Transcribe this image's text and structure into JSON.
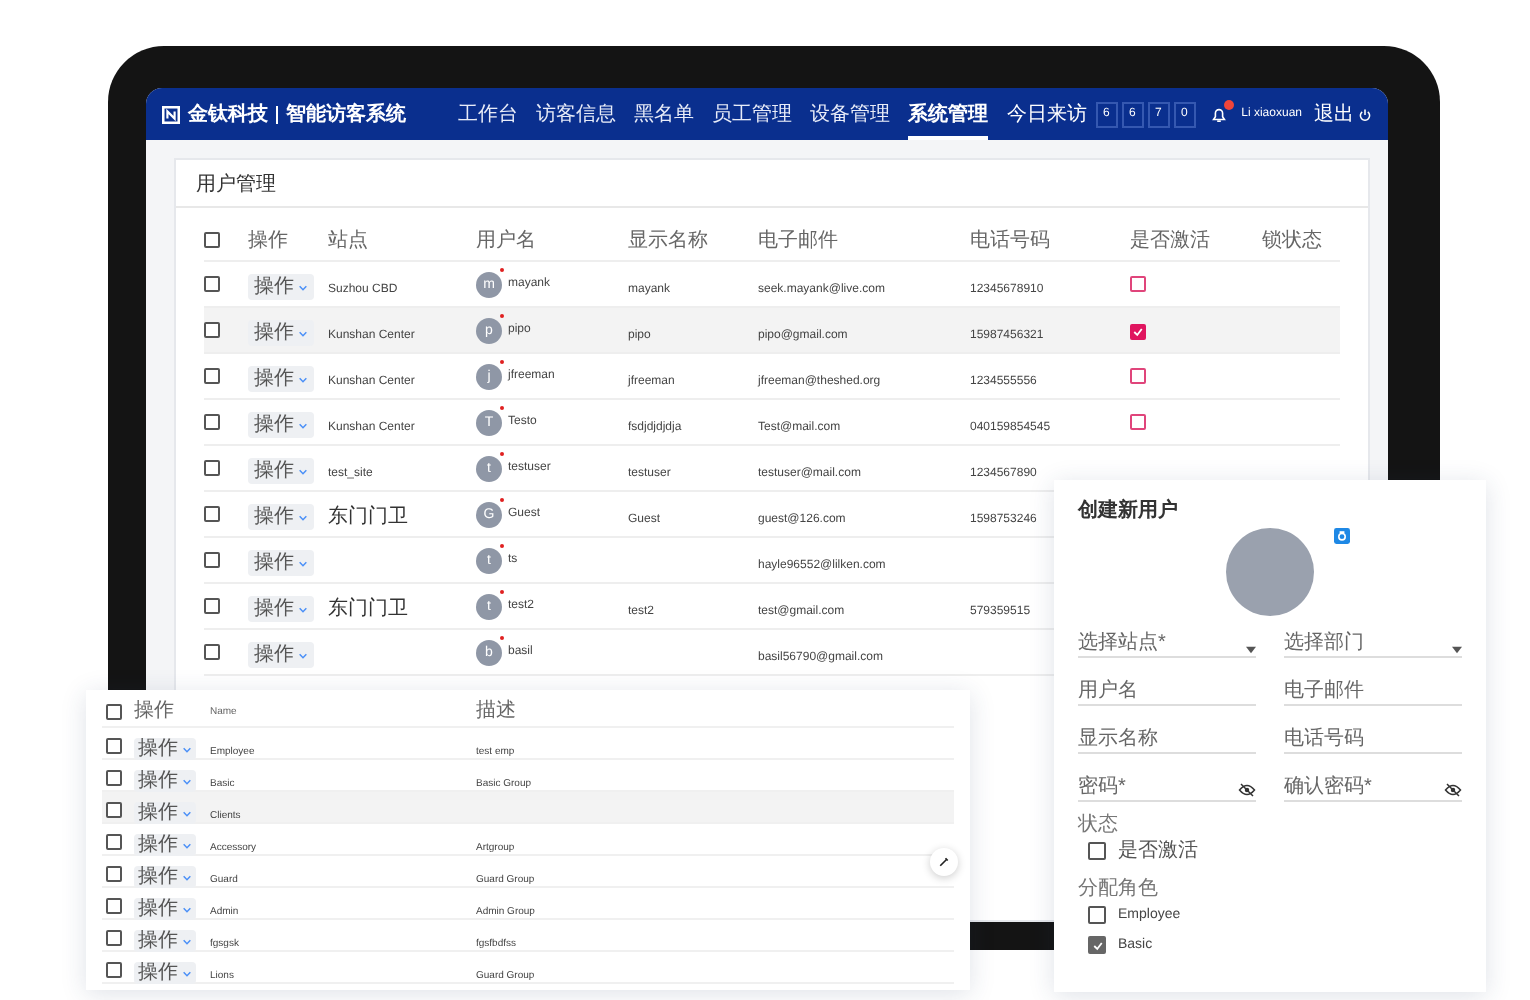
{
  "header": {
    "brand": "金钛科技",
    "product": "智能访客系统",
    "nav": [
      {
        "label": "工作台",
        "selected": false
      },
      {
        "label": "访客信息",
        "selected": false
      },
      {
        "label": "黑名单",
        "selected": false
      },
      {
        "label": "员工管理",
        "selected": false
      },
      {
        "label": "设备管理",
        "selected": false
      },
      {
        "label": "系统管理",
        "selected": true
      }
    ],
    "visits_label": "今日来访",
    "visit_digits": [
      "6",
      "6",
      "7",
      "0"
    ],
    "user": "Li xiaoxuan",
    "logout": "退出"
  },
  "panel": {
    "title": "用户管理"
  },
  "users_table": {
    "all_checked": false,
    "columns": [
      "操作",
      "站点",
      "用户名",
      "显示名称",
      "电子邮件",
      "电话号码",
      "是否激活",
      "锁状态"
    ],
    "rows": [
      {
        "checked": false,
        "selected": false,
        "action": "操作",
        "site": "Suzhou CBD",
        "avatar": "m",
        "username": "mayank",
        "display_name": "mayank",
        "email": "seek.mayank@live.com",
        "phone": "12345678910",
        "active": false
      },
      {
        "checked": false,
        "selected": true,
        "action": "操作",
        "site": "Kunshan Center",
        "avatar": "p",
        "username": "pipo",
        "display_name": "pipo",
        "email": "pipo@gmail.com",
        "phone": "15987456321",
        "active": true
      },
      {
        "checked": false,
        "selected": false,
        "action": "操作",
        "site": "Kunshan Center",
        "avatar": "j",
        "username": "jfreeman",
        "display_name": "jfreeman",
        "email": "jfreeman@theshed.org",
        "phone": "1234555556",
        "active": false
      },
      {
        "checked": false,
        "selected": false,
        "action": "操作",
        "site": "Kunshan Center",
        "avatar": "T",
        "username": "Testo",
        "display_name": "fsdjdjdjdja",
        "email": "Test@mail.com",
        "phone": "040159854545",
        "active": false
      },
      {
        "checked": false,
        "selected": false,
        "action": "操作",
        "site": "test_site",
        "avatar": "t",
        "username": "testuser",
        "display_name": "testuser",
        "email": "testuser@mail.com",
        "phone": "1234567890"
      },
      {
        "checked": false,
        "selected": false,
        "action": "操作",
        "site": "东门门卫",
        "avatar": "G",
        "username": "Guest",
        "display_name": "Guest",
        "email": "guest@126.com",
        "phone": "1598753246"
      },
      {
        "checked": false,
        "selected": false,
        "action": "操作",
        "avatar": "t",
        "username": "ts",
        "email": "hayle96552@lilken.com"
      },
      {
        "checked": false,
        "selected": false,
        "action": "操作",
        "site": "东门门卫",
        "avatar": "t",
        "username": "test2",
        "display_name": "test2",
        "email": "test@gmail.com",
        "phone": "579359515"
      },
      {
        "checked": false,
        "selected": false,
        "action": "操作",
        "avatar": "b",
        "username": "basil",
        "email": "basil56790@gmail.com"
      }
    ]
  },
  "roles_table": {
    "all_checked": false,
    "columns": [
      "操作",
      "Name",
      "描述"
    ],
    "rows": [
      {
        "checked": false,
        "selected": false,
        "action": "操作",
        "name": "Employee",
        "description": "test emp"
      },
      {
        "checked": false,
        "selected": false,
        "action": "操作",
        "name": "Basic",
        "description": "Basic Group"
      },
      {
        "checked": false,
        "selected": true,
        "action": "操作",
        "name": "Clients"
      },
      {
        "checked": false,
        "selected": false,
        "action": "操作",
        "name": "Accessory",
        "description": "Artgroup"
      },
      {
        "checked": false,
        "selected": false,
        "action": "操作",
        "name": "Guard",
        "description": "Guard Group"
      },
      {
        "checked": false,
        "selected": false,
        "action": "操作",
        "name": "Admin",
        "description": "Admin Group"
      },
      {
        "checked": false,
        "selected": false,
        "action": "操作",
        "name": "fgsgsk",
        "description": "fgsfbdfss"
      },
      {
        "checked": false,
        "selected": false,
        "action": "操作",
        "name": "Lions",
        "description": "Guard Group"
      }
    ]
  },
  "dialog": {
    "title": "创建新用户",
    "fields": [
      {
        "kind": "select",
        "label": "选择站点*"
      },
      {
        "kind": "select",
        "label": "选择部门"
      },
      {
        "kind": "text",
        "label": "用户名"
      },
      {
        "kind": "text",
        "label": "电子邮件"
      },
      {
        "kind": "text",
        "label": "显示名称"
      },
      {
        "kind": "text",
        "label": "电话号码"
      },
      {
        "kind": "password",
        "label": "密码*"
      },
      {
        "kind": "password",
        "label": "确认密码*"
      }
    ],
    "status_label": "状态",
    "status_options": [
      {
        "label": "是否激活",
        "checked": false
      }
    ],
    "roles_label": "分配角色",
    "roles": [
      {
        "label": "Employee",
        "checked": false
      },
      {
        "label": "Basic",
        "checked": true
      }
    ]
  }
}
